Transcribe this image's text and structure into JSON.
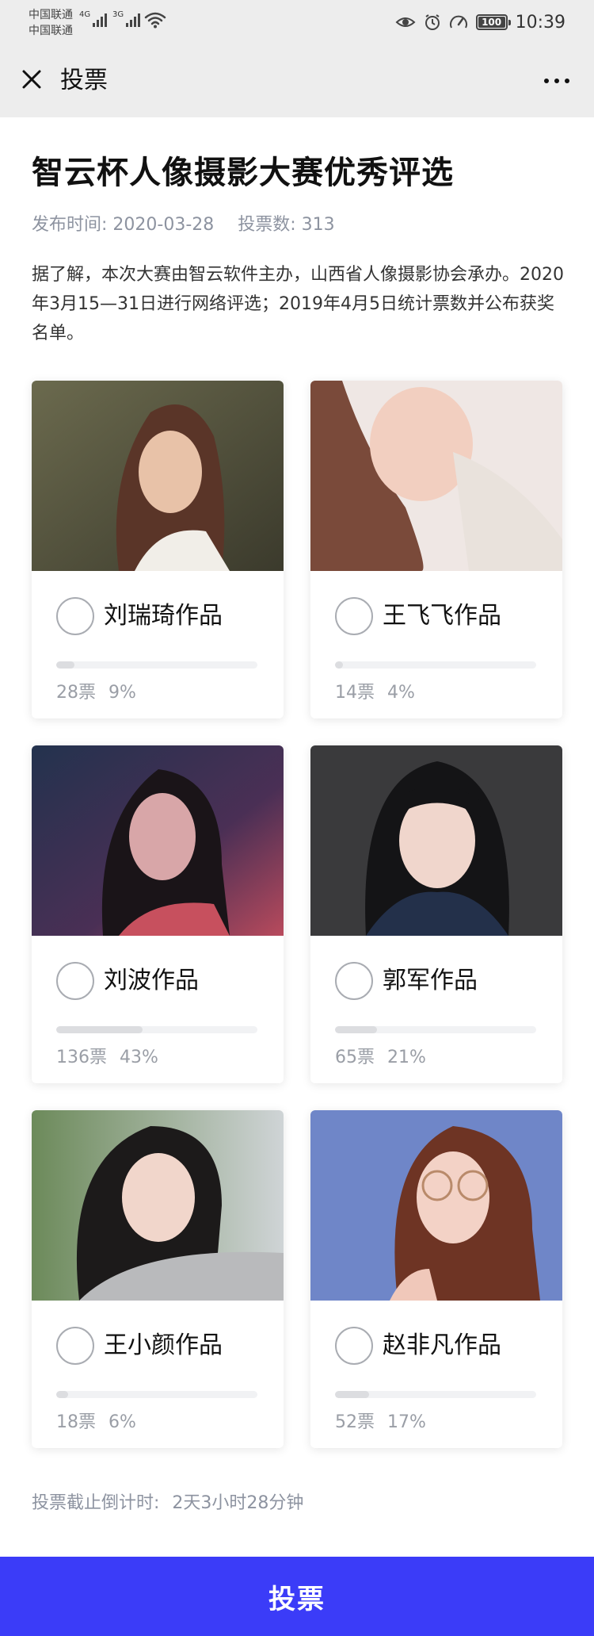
{
  "status_bar": {
    "carrier_1": "中国联通",
    "carrier_2": "中国联通",
    "net_1": "4G",
    "net_2": "3G",
    "battery": "100",
    "time": "10:39"
  },
  "nav": {
    "title": "投票",
    "close_icon": "close-icon",
    "more_icon": "more-dots-icon"
  },
  "article": {
    "title": "智云杯人像摄影大赛优秀评选",
    "publish_time": "发布时间: 2020-03-28",
    "vote_count": "投票数: 313",
    "description": "据了解，本次大赛由智云软件主办，山西省人像摄影协会承办。2020年3月15—31日进行网络评选；2019年4月5日统计票数并公布获奖名单。"
  },
  "candidates": [
    {
      "name": "刘瑞琦作品",
      "votes": "28票",
      "percent": "9%",
      "share": 0.09,
      "photo": "portrait-photo"
    },
    {
      "name": "王飞飞作品",
      "votes": "14票",
      "percent": "4%",
      "share": 0.04,
      "photo": "portrait-photo"
    },
    {
      "name": "刘波作品",
      "votes": "136票",
      "percent": "43%",
      "share": 0.43,
      "photo": "portrait-photo"
    },
    {
      "name": "郭军作品",
      "votes": "65票",
      "percent": "21%",
      "share": 0.21,
      "photo": "portrait-photo"
    },
    {
      "name": "王小颜作品",
      "votes": "18票",
      "percent": "6%",
      "share": 0.06,
      "photo": "portrait-photo"
    },
    {
      "name": "赵非凡作品",
      "votes": "52票",
      "percent": "17%",
      "share": 0.17,
      "photo": "portrait-photo"
    }
  ],
  "footer": {
    "countdown_label": "投票截止倒计时:",
    "countdown_value": "2天3小时28分钟",
    "vote_button": "投票"
  },
  "colors": {
    "accent": "#3b3cf8",
    "nav_bg": "#ededed",
    "muted_text": "#8d93a0"
  }
}
